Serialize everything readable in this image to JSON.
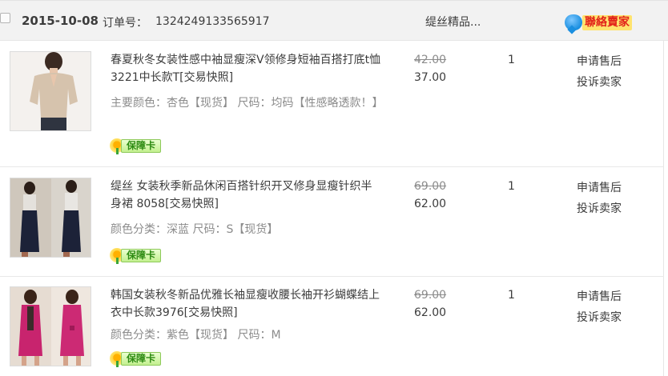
{
  "order": {
    "date": "2015-10-08",
    "order_no_label": "订单号：",
    "order_no": "1324249133565917",
    "shop_name": "缇丝精品...",
    "contact_label": "聯絡賣家"
  },
  "items": [
    {
      "title": "春夏秋冬女装性感中袖显瘦深V领修身短袖百搭打底t恤3221中长款T[交易快照]",
      "attrs": "主要颜色：杏色【现货】 尺码：均码【性感略透款！】",
      "guarantee_label": "保障卡",
      "price_original": "42.00",
      "price_paid": "37.00",
      "quantity": "1",
      "action_after_sale": "申请售后",
      "action_complain": "投诉卖家"
    },
    {
      "title": "缇丝 女装秋季新品休闲百搭针织开叉修身显瘦针织半身裙 8058[交易快照]",
      "attrs": "颜色分类：深蓝 尺码：S【现货】",
      "guarantee_label": "保障卡",
      "price_original": "69.00",
      "price_paid": "62.00",
      "quantity": "1",
      "action_after_sale": "申请售后",
      "action_complain": "投诉卖家"
    },
    {
      "title": "韩国女装秋冬新品优雅长袖显瘦收腰长袖开衫蝴蝶结上衣中长款3976[交易快照]",
      "attrs": "颜色分类：紫色【现货】 尺码：M",
      "guarantee_label": "保障卡",
      "price_original": "69.00",
      "price_paid": "62.00",
      "quantity": "1",
      "action_after_sale": "申请售后",
      "action_complain": "投诉卖家"
    }
  ]
}
